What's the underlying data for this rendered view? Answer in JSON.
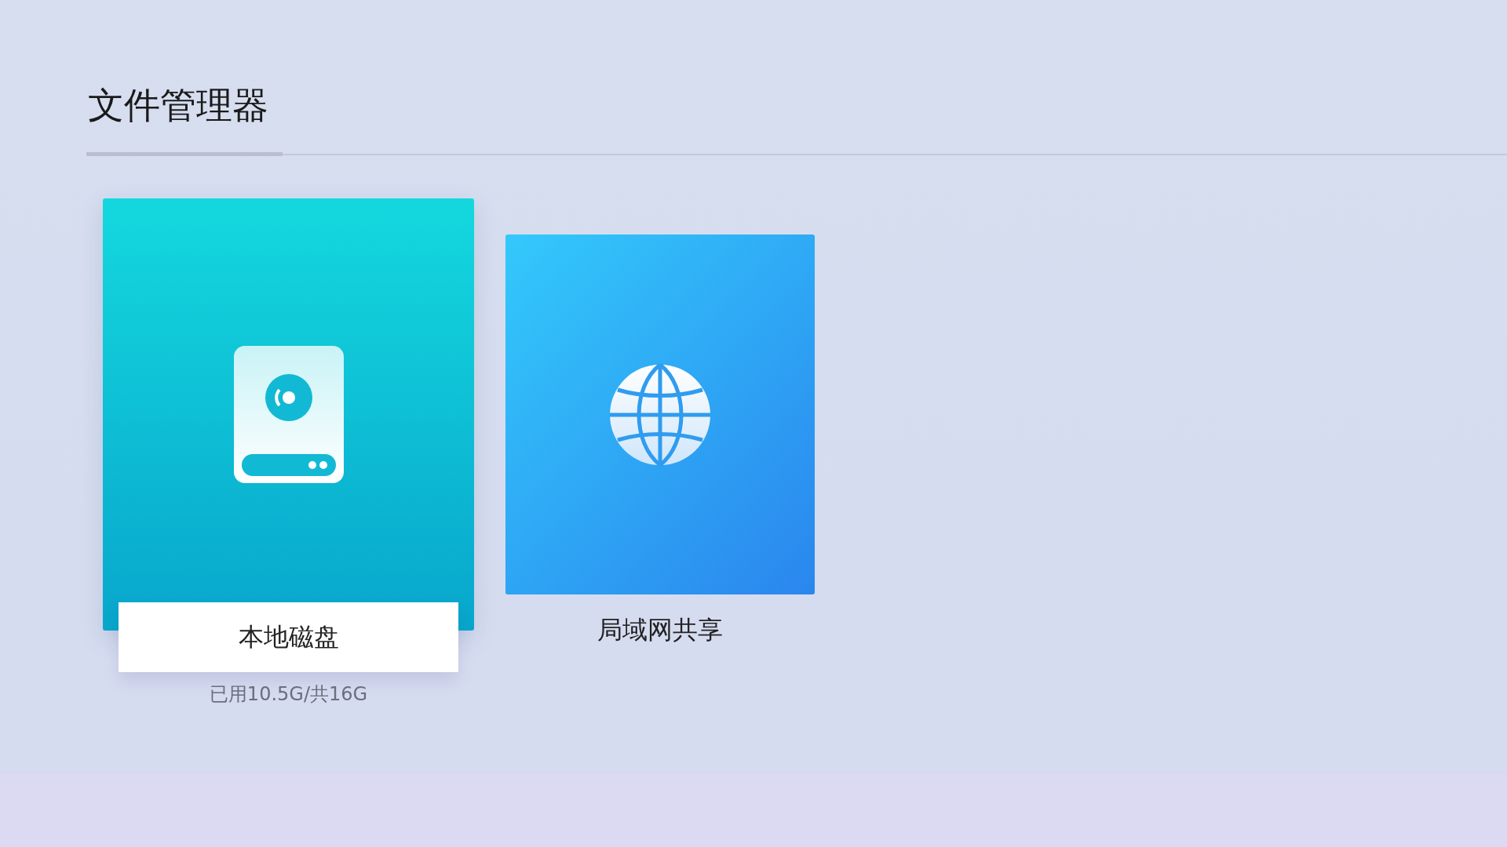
{
  "header": {
    "title": "文件管理器",
    "selected": true
  },
  "items": [
    {
      "kind": "disk",
      "label": "本地磁盘",
      "subtitle": "已用10.5G/共16G",
      "selected": true
    },
    {
      "kind": "network",
      "label": "局域网共享",
      "selected": false
    }
  ]
}
